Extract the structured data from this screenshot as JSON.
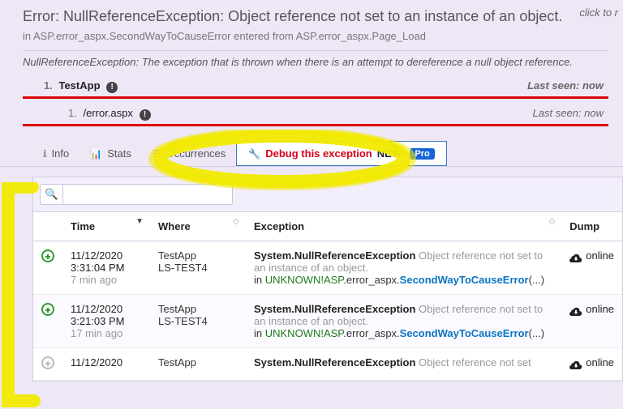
{
  "header": {
    "title": "Error: NullReferenceException: Object reference not set to an instance of an object.",
    "click_hint": "click to r",
    "subpath": "in ASP.error_aspx.SecondWayToCauseError entered from ASP.error_aspx.Page_Load",
    "description": "NullReferenceException: The exception that is thrown when there is an attempt to dereference a null object reference."
  },
  "tree": {
    "item1": {
      "num": "1.",
      "label": "TestApp",
      "last_seen": "Last seen: now"
    },
    "item2": {
      "num": "1.",
      "label": "/error.aspx",
      "last_seen": "Last seen: now"
    }
  },
  "tabs": {
    "info": "Info",
    "stats": "Stats",
    "occurrences": "Occurrences",
    "debug": "Debug this exception",
    "new": "NEW!",
    "pro": "Pro"
  },
  "search": {
    "placeholder": ""
  },
  "columns": {
    "expand": "",
    "time": "Time",
    "where": "Where",
    "exception": "Exception",
    "dump": "Dump"
  },
  "rows": [
    {
      "time_date": "11/12/2020",
      "time_clock": "3:31:04 PM",
      "time_ago": "7 min ago",
      "where_app": "TestApp",
      "where_host": "LS-TEST4",
      "exc_type": "System.NullReferenceException",
      "exc_msg": " Object reference not set to an instance of an object.",
      "exc_in": "in ",
      "exc_unknown": "UNKNOWN!",
      "exc_asp": "ASP",
      "exc_mid": ".error_aspx.",
      "exc_method": "SecondWayToCauseError",
      "exc_tail": "(...)",
      "dump": "online"
    },
    {
      "time_date": "11/12/2020",
      "time_clock": "3:21:03 PM",
      "time_ago": "17 min ago",
      "where_app": "TestApp",
      "where_host": "LS-TEST4",
      "exc_type": "System.NullReferenceException",
      "exc_msg": " Object reference not set to an instance of an object.",
      "exc_in": "in ",
      "exc_unknown": "UNKNOWN!",
      "exc_asp": "ASP",
      "exc_mid": ".error_aspx.",
      "exc_method": "SecondWayToCauseError",
      "exc_tail": "(...)",
      "dump": "online"
    },
    {
      "time_date": "11/12/2020",
      "time_clock": "",
      "time_ago": "",
      "where_app": "TestApp",
      "where_host": "",
      "exc_type": "System.NullReferenceException",
      "exc_msg": " Object reference not set",
      "exc_in": "",
      "exc_unknown": "",
      "exc_asp": "",
      "exc_mid": "",
      "exc_method": "",
      "exc_tail": "",
      "dump": "online"
    }
  ]
}
